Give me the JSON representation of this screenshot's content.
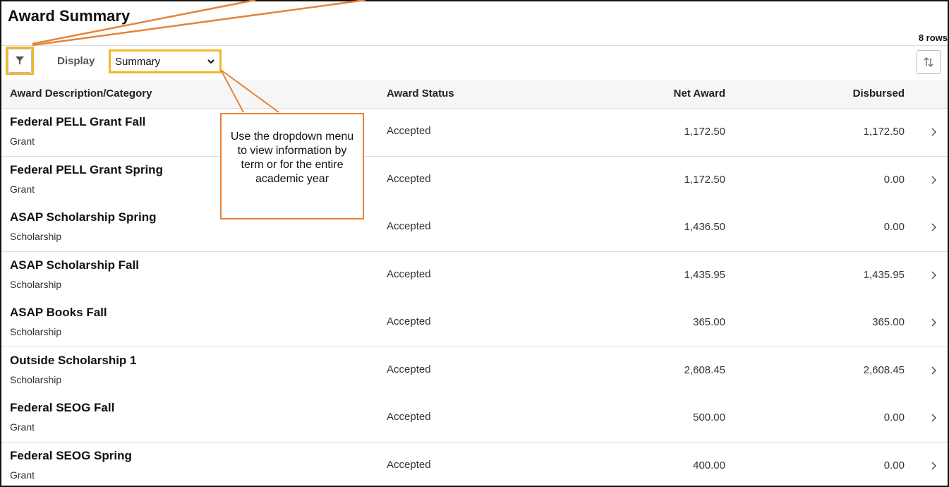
{
  "header": {
    "title": "Award Summary",
    "row_count": "8 rows"
  },
  "toolbar": {
    "display_label": "Display",
    "display_select_value": "Summary"
  },
  "columns": {
    "description": "Award Description/Category",
    "status": "Award Status",
    "net": "Net Award",
    "disbursed": "Disbursed"
  },
  "rows": [
    {
      "name": "Federal PELL Grant Fall",
      "category": "Grant",
      "status": "Accepted",
      "net": "1,172.50",
      "disbursed": "1,172.50"
    },
    {
      "name": "Federal PELL Grant Spring",
      "category": "Grant",
      "status": "Accepted",
      "net": "1,172.50",
      "disbursed": "0.00"
    },
    {
      "name": "ASAP Scholarship Spring",
      "category": "Scholarship",
      "status": "Accepted",
      "net": "1,436.50",
      "disbursed": "0.00"
    },
    {
      "name": "ASAP Scholarship Fall",
      "category": "Scholarship",
      "status": "Accepted",
      "net": "1,435.95",
      "disbursed": "1,435.95"
    },
    {
      "name": "ASAP Books Fall",
      "category": "Scholarship",
      "status": "Accepted",
      "net": "365.00",
      "disbursed": "365.00"
    },
    {
      "name": "Outside Scholarship 1",
      "category": "Scholarship",
      "status": "Accepted",
      "net": "2,608.45",
      "disbursed": "2,608.45"
    },
    {
      "name": "Federal SEOG Fall",
      "category": "Grant",
      "status": "Accepted",
      "net": "500.00",
      "disbursed": "0.00"
    },
    {
      "name": "Federal SEOG Spring",
      "category": "Grant",
      "status": "Accepted",
      "net": "400.00",
      "disbursed": "0.00"
    }
  ],
  "callout": {
    "text": "Use the dropdown menu to view information by term or for the entire academic year"
  },
  "colors": {
    "highlight": "#f2b824",
    "callout_border": "#e5833a"
  },
  "icons": {
    "filter": "filter-icon",
    "sort": "sort-icon",
    "row_arrow": "chevron-right-icon",
    "select": "chevron-down-icon"
  }
}
